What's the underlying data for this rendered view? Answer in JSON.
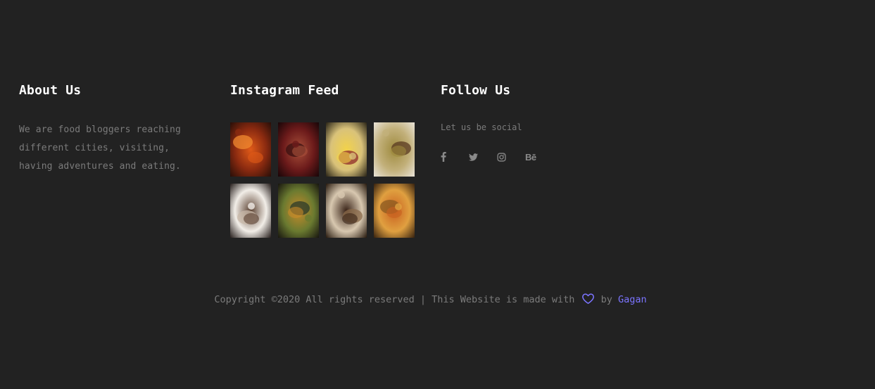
{
  "about": {
    "heading": "About Us",
    "text_line1": "We are food bloggers reaching",
    "text_line2": "different cities, visiting,",
    "text_line3": "having adventures and eating."
  },
  "instagram": {
    "heading": "Instagram Feed",
    "items": [
      {
        "name": "instagram-photo-grilled-meat",
        "colors": [
          "#2a0f08",
          "#8a2a10",
          "#e05a18",
          "#f08a30"
        ]
      },
      {
        "name": "instagram-photo-pizza",
        "colors": [
          "#1a0608",
          "#6b1a1a",
          "#a8503a",
          "#3a1010"
        ]
      },
      {
        "name": "instagram-photo-thali-plate",
        "colors": [
          "#2c2618",
          "#d9c27a",
          "#f2d24a",
          "#8f2b2b"
        ]
      },
      {
        "name": "instagram-photo-paratha-curry",
        "colors": [
          "#e8e2d6",
          "#c2b07a",
          "#9e8a3e",
          "#5a3a20"
        ]
      },
      {
        "name": "instagram-photo-cold-coffee",
        "colors": [
          "#2a2220",
          "#f2eee8",
          "#5a4030",
          "#c8b8a8"
        ]
      },
      {
        "name": "instagram-photo-rolls",
        "colors": [
          "#1a1810",
          "#6a7a30",
          "#c88a2a",
          "#2a3a2a"
        ]
      },
      {
        "name": "instagram-photo-dessert-tray",
        "colors": [
          "#2a1c10",
          "#d8c8b0",
          "#3a2418",
          "#8a6a4a"
        ]
      },
      {
        "name": "instagram-photo-nachos",
        "colors": [
          "#3a2410",
          "#e0a040",
          "#c86020",
          "#8a5a20"
        ]
      }
    ]
  },
  "follow": {
    "heading": "Follow Us",
    "tagline": "Let us be social",
    "icons": [
      {
        "name": "facebook-icon"
      },
      {
        "name": "twitter-icon"
      },
      {
        "name": "instagram-icon"
      },
      {
        "name": "behance-icon",
        "label": "Bē"
      }
    ]
  },
  "footer": {
    "copyright_prefix": "Copyright ©2020 All rights reserved | This Website is made with",
    "by_text": "by",
    "author": "Gagan",
    "accent_color": "#7b74ff",
    "heart_icon": "heart-icon"
  }
}
